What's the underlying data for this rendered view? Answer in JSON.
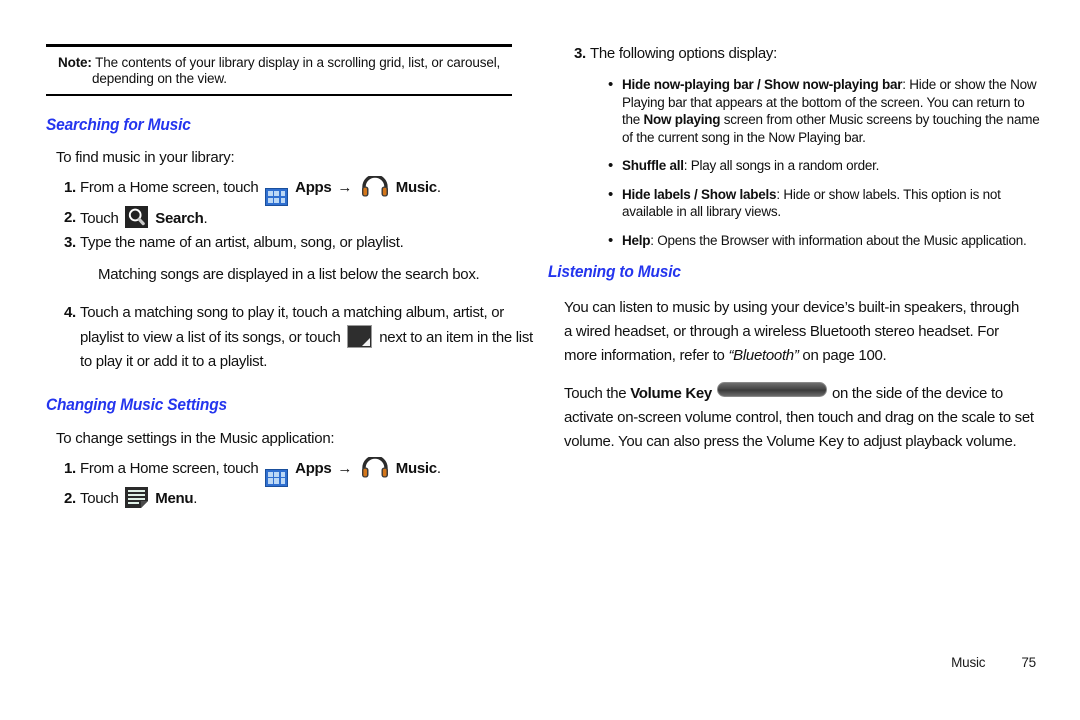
{
  "note": {
    "label": "Note:",
    "text": "The contents of your library display in a scrolling grid, list, or carousel, depending on the view."
  },
  "left_column": {
    "sections": [
      {
        "heading": "Searching for Music",
        "lead": "To find music in your library:",
        "steps": [
          {
            "num": "1.",
            "pre": "From a Home screen, touch",
            "apps_label": "Apps",
            "arrow": "→",
            "music_label": "Music",
            "post": "."
          },
          {
            "num": "2.",
            "pre": "Touch",
            "label": "Search",
            "post": "."
          },
          {
            "num": "3.",
            "text": "Type the name of an artist, album, song, or playlist.",
            "continuation": "Matching songs are displayed in a list below the search box."
          },
          {
            "num": "4.",
            "text_a": "Touch a matching song to play it, touch a matching album, artist, or playlist to view a list of its songs, or touch",
            "text_b": "next to an item in the list to play it or add it to a playlist."
          }
        ]
      },
      {
        "heading": "Changing Music Settings",
        "lead": "To change settings in the Music application:",
        "steps": [
          {
            "num": "1.",
            "pre": "From a Home screen, touch",
            "apps_label": "Apps",
            "arrow": "→",
            "music_label": "Music",
            "post": "."
          },
          {
            "num": "2.",
            "pre": "Touch",
            "label": "Menu",
            "post": "."
          }
        ]
      }
    ]
  },
  "right_column": {
    "step3": {
      "num": "3.",
      "text": "The following options display:"
    },
    "options": [
      {
        "term": "Hide now-playing bar / Show now-playing bar",
        "desc_a": ": Hide or show the Now Playing bar that appears at the bottom of the screen. You can return to the ",
        "desc_bold": "Now playing",
        "desc_b": " screen from other Music screens by touching the name of the current song in the Now Playing bar."
      },
      {
        "term": "Shuffle all",
        "desc_a": ": Play all songs in a random order.",
        "desc_bold": "",
        "desc_b": ""
      },
      {
        "term": "Hide labels / Show labels",
        "desc_a": ": Hide or show labels. This option is not available in all library views.",
        "desc_bold": "",
        "desc_b": ""
      },
      {
        "term": "Help",
        "desc_a": ": Opens the Browser with information about the Music application.",
        "desc_bold": "",
        "desc_b": ""
      }
    ],
    "listening": {
      "heading": "Listening to Music",
      "para_a": "You can listen to music by using your device’s built-in speakers, through a wired headset, or through a wireless Bluetooth stereo headset. For more information, refer to ",
      "para_italic": "“Bluetooth”",
      "para_b": " on page 100.",
      "volume_pre": "Touch the ",
      "volume_bold": "Volume Key",
      "volume_post": "on the side of the device to activate on-screen volume control, then touch and drag on the scale to set volume. You can also press the Volume Key to adjust playback volume."
    }
  },
  "footer": {
    "label": "Music",
    "page": "75"
  },
  "colors": {
    "heading_blue": "#2435ee",
    "apps_icon_blue": "#2f6fd0",
    "icon_dark": "#232323",
    "music_accent_orange": "#d4761a"
  }
}
